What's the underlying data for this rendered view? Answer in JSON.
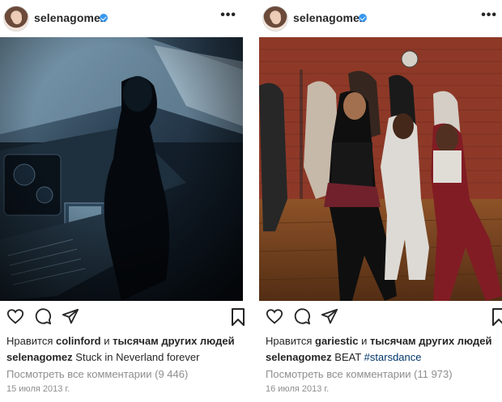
{
  "posts": [
    {
      "username": "selenagomez",
      "more_label": "•••",
      "likes_prefix": "Нравится",
      "likes_user": "colinford",
      "likes_and": "и",
      "likes_others": "тысячам других людей",
      "caption_user": "selenagomez",
      "caption_text": "Stuck in Neverland forever",
      "caption_hashtag": "",
      "comments_link": "Посмотреть все комментарии (9 446)",
      "date": "15 июля 2013 г."
    },
    {
      "username": "selenagomez",
      "more_label": "•••",
      "likes_prefix": "Нравится",
      "likes_user": "gariestic",
      "likes_and": "и",
      "likes_others": "тысячам других людей",
      "caption_user": "selenagomez",
      "caption_text": "BEAT",
      "caption_hashtag": "#starsdance",
      "comments_link": "Посмотреть все комментарии (11 973)",
      "date": "16 июля 2013 г."
    }
  ],
  "icons": {
    "like": "heart-outline-icon",
    "comment": "comment-bubble-icon",
    "share": "paper-plane-icon",
    "save": "bookmark-icon",
    "verified": "verified-badge-icon"
  },
  "colors": {
    "verified": "#3897f0",
    "text": "#262626",
    "muted": "#8e8e8e",
    "hashtag": "#003569"
  }
}
